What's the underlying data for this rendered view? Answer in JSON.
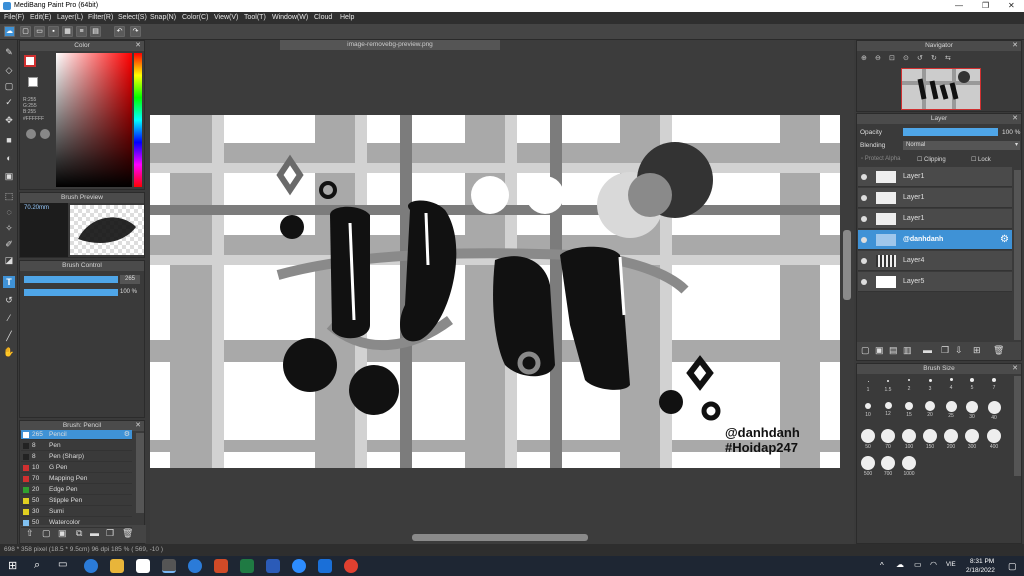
{
  "window": {
    "title": "MediBang Paint Pro (64bit)",
    "controls": [
      "—",
      "❐",
      "✕"
    ]
  },
  "menu": [
    "File(F)",
    "Edit(E)",
    "Layer(L)",
    "Filter(R)",
    "Select(S)",
    "Snap(N)",
    "Color(C)",
    "View(V)",
    "Tool(T)",
    "Window(W)",
    "Cloud",
    "Help"
  ],
  "document": {
    "tab": "image-removebg-preview.png"
  },
  "color_panel": {
    "title": "Color",
    "r": "R:255",
    "g": "G:255",
    "b": "B:255",
    "hex": "#FFFFFF"
  },
  "brush_preview": {
    "title": "Brush Preview",
    "size": "70.20mm"
  },
  "brush_control": {
    "title": "Brush Control",
    "size_value": "265",
    "opacity_value": "100 %"
  },
  "brush_list": {
    "title": "Brush: Pencil",
    "items": [
      {
        "size": "265",
        "name": "Pencil",
        "color": "#ffffff"
      },
      {
        "size": "8",
        "name": "Pen",
        "color": "#222222"
      },
      {
        "size": "8",
        "name": "Pen (Sharp)",
        "color": "#222222"
      },
      {
        "size": "10",
        "name": "G Pen",
        "color": "#d03030"
      },
      {
        "size": "70",
        "name": "Mapping Pen",
        "color": "#d03030"
      },
      {
        "size": "20",
        "name": "Edge Pen",
        "color": "#30a030"
      },
      {
        "size": "50",
        "name": "Stipple Pen",
        "color": "#e0d020"
      },
      {
        "size": "30",
        "name": "Sumi",
        "color": "#e0d020"
      },
      {
        "size": "50",
        "name": "Watercolor",
        "color": "#80c0f0"
      }
    ]
  },
  "navigator": {
    "title": "Navigator"
  },
  "layer_panel": {
    "title": "Layer",
    "opacity_label": "Opacity",
    "opacity_value": "100 %",
    "blending_label": "Blending",
    "blending_value": "Normal",
    "protect_alpha": "Protect Alpha",
    "clipping": "Clipping",
    "lock": "Lock",
    "layers": [
      {
        "name": "Layer1",
        "selected": false
      },
      {
        "name": "Layer1",
        "selected": false
      },
      {
        "name": "Layer1",
        "selected": false
      },
      {
        "name": "@danhdanh",
        "selected": true
      },
      {
        "name": "Layer4",
        "selected": false
      },
      {
        "name": "Layer5",
        "selected": false
      }
    ]
  },
  "brush_size": {
    "title": "Brush Size",
    "sizes": [
      "1",
      "1.5",
      "2",
      "3",
      "4",
      "5",
      "7",
      "10",
      "12",
      "15",
      "20",
      "25",
      "30",
      "40",
      "50",
      "70",
      "100",
      "150",
      "200",
      "300",
      "400",
      "500",
      "700",
      "1000"
    ]
  },
  "artwork": {
    "handle": "@danhdanh",
    "tag": "#Hoidap247"
  },
  "status": {
    "text": "698 * 358 pixel    (18.5 * 9.5cm)   96 dpi   185 %   ( 569, -10 )"
  },
  "taskbar": {
    "time": "8:31 PM",
    "date": "2/18/2022",
    "lang": "VIE"
  }
}
